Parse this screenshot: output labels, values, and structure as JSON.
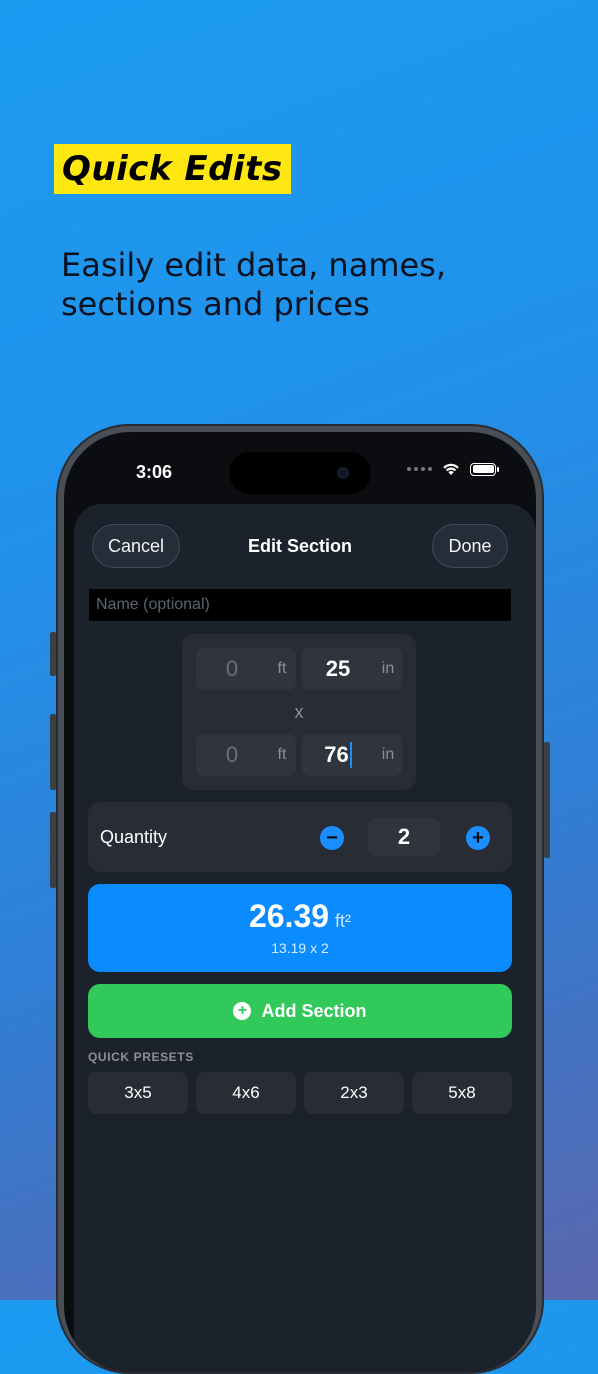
{
  "marketing": {
    "badge": "Quick Edits",
    "subheading": "Easily edit data, names, sections and prices"
  },
  "status_bar": {
    "time": "3:06",
    "icons": [
      "cellular-dots-icon",
      "wifi-icon",
      "battery-icon"
    ]
  },
  "nav": {
    "cancel_label": "Cancel",
    "title": "Edit Section",
    "done_label": "Done"
  },
  "name_field": {
    "placeholder": "Name (optional)",
    "value": ""
  },
  "dimensions": {
    "row1": {
      "feet": "0",
      "feet_unit": "ft",
      "inches": "25",
      "inches_unit": "in"
    },
    "separator": "x",
    "row2": {
      "feet": "0",
      "feet_unit": "ft",
      "inches": "76",
      "inches_unit": "in"
    }
  },
  "quantity": {
    "label": "Quantity",
    "value": "2",
    "decrement_symbol": "−",
    "increment_symbol": "+"
  },
  "area": {
    "value": "26.39",
    "unit": "ft²",
    "breakdown": "13.19 x 2"
  },
  "add_button": {
    "label": "Add Section",
    "icon": "plus-circle-icon"
  },
  "presets": {
    "label": "QUICK PRESETS",
    "items": [
      "3x5",
      "4x6",
      "2x3",
      "5x8"
    ]
  },
  "colors": {
    "accent_blue": "#0a8bff",
    "add_green": "#31c95a",
    "badge_yellow": "#ffe812",
    "sheet_bg": "#1c222c"
  }
}
